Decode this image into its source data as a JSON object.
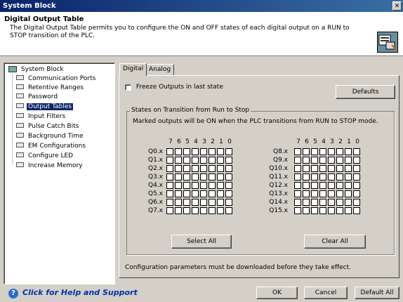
{
  "window": {
    "title": "System Block",
    "close_glyph": "✕"
  },
  "header": {
    "title": "Digital Output Table",
    "description": "The Digital Output Table permits you to configure the ON and OFF states of each digital output on a RUN to STOP transition of the PLC.",
    "icon": "output-table-icon"
  },
  "tree": {
    "root": "System Block",
    "items": [
      "Communication Ports",
      "Retentive Ranges",
      "Password",
      "Output Tables",
      "Input Filters",
      "Pulse Catch Bits",
      "Background Time",
      "EM Configurations",
      "Configure LED",
      "Increase Memory"
    ],
    "selected": "Output Tables"
  },
  "tabs": [
    "Digital",
    "Analog"
  ],
  "panel": {
    "freeze_label": "Freeze Outputs in last state",
    "defaults_button": "Defaults",
    "group_title": "States on Transition from Run to Stop",
    "group_desc": "Marked outputs will be ON when the PLC transitions from RUN to STOP mode.",
    "bit_headers": [
      "7",
      "6",
      "5",
      "4",
      "3",
      "2",
      "1",
      "0"
    ],
    "left_rows": [
      "Q0.x",
      "Q1.x",
      "Q2.x",
      "Q3.x",
      "Q4.x",
      "Q5.x",
      "Q6.x",
      "Q7.x"
    ],
    "right_rows": [
      "Q8.x",
      "Q9.x",
      "Q10.x",
      "Q11.x",
      "Q12.x",
      "Q13.x",
      "Q14.x",
      "Q15.x"
    ],
    "select_all_button": "Select All",
    "clear_all_button": "Clear All",
    "note": "Configuration parameters must be downloaded before they take effect."
  },
  "footer": {
    "help_text": "Click for Help and Support",
    "ok_button": "OK",
    "cancel_button": "Cancel",
    "default_all_button": "Default All"
  }
}
